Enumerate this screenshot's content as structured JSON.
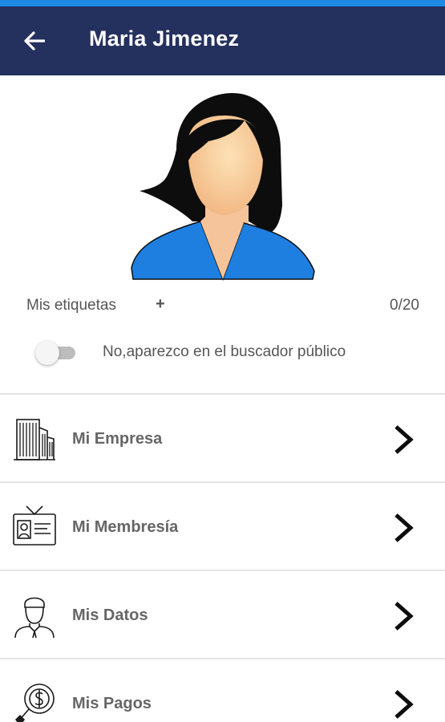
{
  "header": {
    "title": "Maria Jimenez",
    "back_icon": "arrow-left-icon"
  },
  "profile": {
    "avatar_icon": "woman-avatar",
    "tags_label": "Mis etiquetas",
    "tags_add": "+",
    "tags_count": "0/20",
    "visibility_toggle": {
      "state": "off",
      "label": "No,aparezco en el buscador público"
    }
  },
  "menu": {
    "items": [
      {
        "label": "Mi Empresa",
        "icon": "building-icon"
      },
      {
        "label": "Mi Membresía",
        "icon": "id-card-icon"
      },
      {
        "label": "Mis Datos",
        "icon": "user-profile-icon"
      },
      {
        "label": "Mis Pagos",
        "icon": "payments-search-icon"
      }
    ]
  },
  "colors": {
    "app_bar": "#24305e",
    "status_strip": "#1e88e5",
    "avatar_shirt": "#1e88e5"
  }
}
